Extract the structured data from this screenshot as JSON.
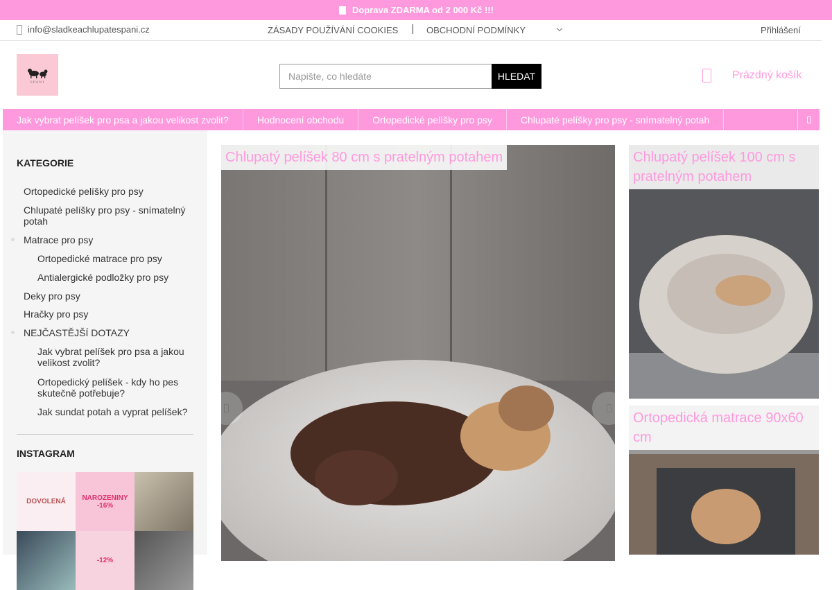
{
  "promo_bar": {
    "text": "Doprava ZDARMA od 2 000 Kč !!!",
    "icon": "truck-icon"
  },
  "top_links": {
    "email": "info@sladkeachlupatespani.cz",
    "email_icon": "phone-icon",
    "cookies": "ZÁSADY POUŽÍVÁNÍ COOKIES",
    "terms": "OBCHODNÍ PODMÍNKY",
    "login": "Přihlášení"
  },
  "header": {
    "logo_text": "SPANI",
    "search_placeholder": "Napište, co hledáte",
    "search_button": "HLEDAT",
    "cart_label": "Prázdný košík",
    "cart_icon": "shopping-bag-icon"
  },
  "menu": {
    "items": [
      "Jak vybrat pelíšek pro psa a jakou velikost zvolit?",
      "Hodnocení obchodu",
      "Ortopedické pelíšky pro psy",
      "Chlupaté pelíšky pro psy - snímatelný potah"
    ]
  },
  "sidebar": {
    "categories_title": "KATEGORIE",
    "categories": [
      "Ortopedické pelíšky pro psy",
      "Chlupaté pelíšky pro psy - snímatelný potah",
      "Matrace pro psy",
      "Ortopedické matrace pro psy",
      "Antialergické podložky pro psy",
      "Deky pro psy",
      "Hračky pro psy",
      "NEJČASTĚJŠÍ DOTAZY",
      "Jak vybrat pelíšek pro psa a jakou velikost zvolit?",
      "Ortopedický pelíšek - kdy ho pes skutečně potřebuje?",
      "Jak sundat potah a vyprat pelíšek?"
    ],
    "instagram_title": "INSTAGRAM",
    "instagram_tiles": [
      "DOVOLENÁ",
      "NAROZENINY -16%",
      "",
      "",
      "-12%",
      ""
    ]
  },
  "main_banner": {
    "caption": "Chlupatý pelíšek 80 cm s pratelným potahem"
  },
  "side_banners": [
    {
      "caption": "Chlupatý pelíšek 100 cm s pratelným potahem"
    },
    {
      "caption": "Ortopedická matrace 90x60 cm"
    }
  ],
  "colors": {
    "brand_pink": "#ff99dd",
    "logo_bg": "#fbc9d6"
  }
}
